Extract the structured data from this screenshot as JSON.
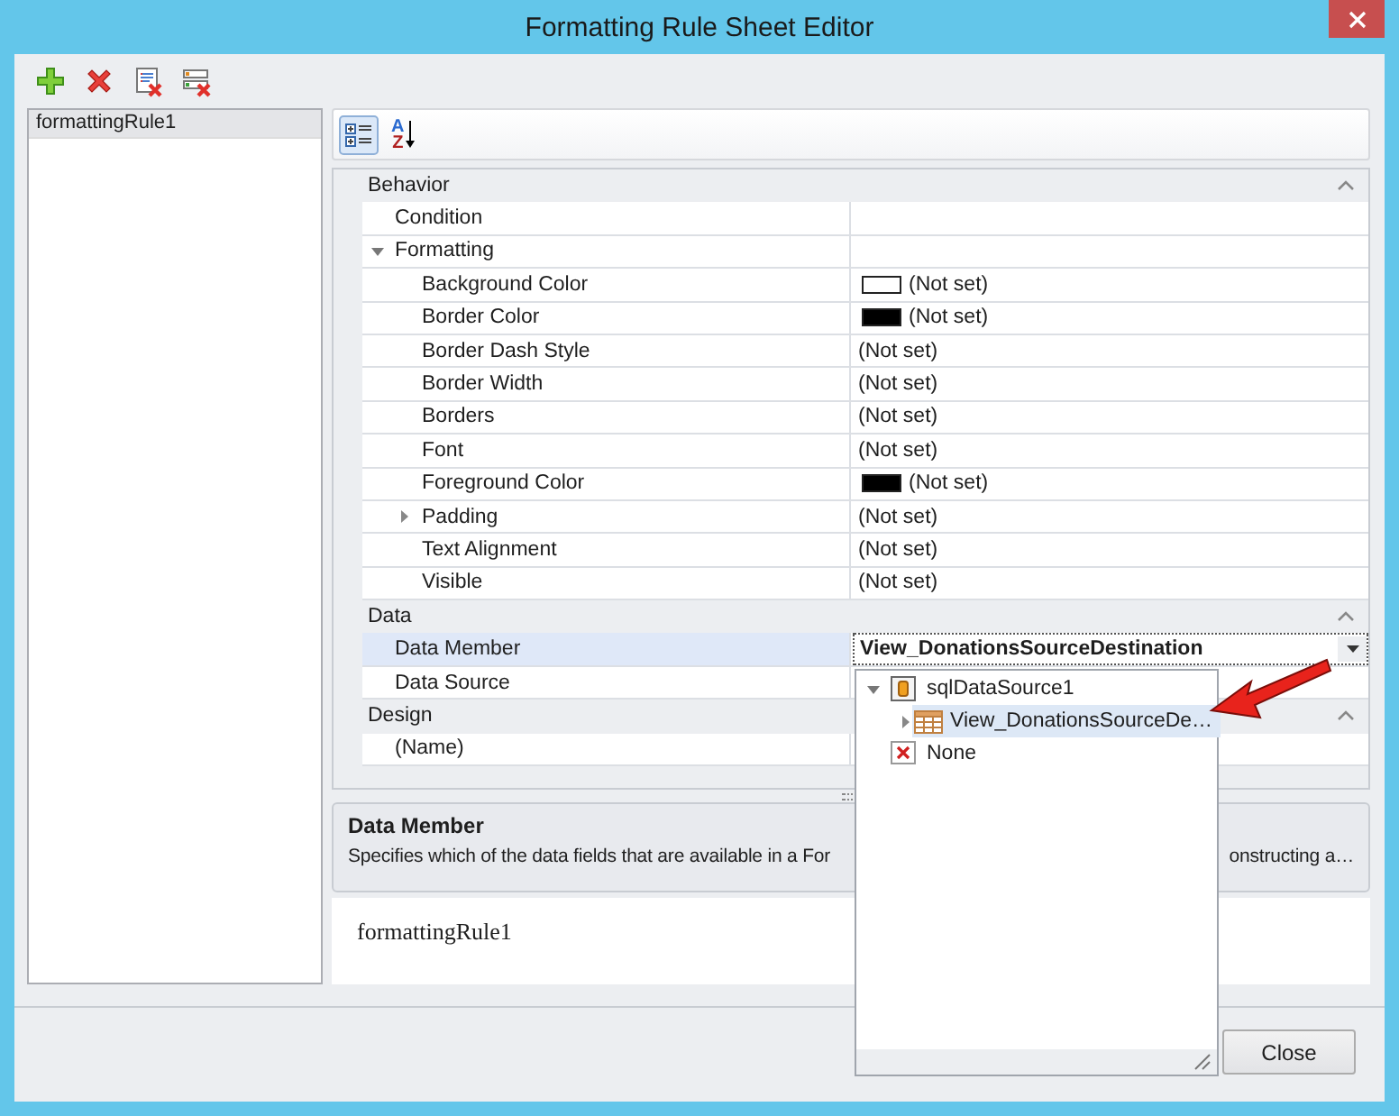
{
  "window": {
    "title": "Formatting Rule Sheet Editor"
  },
  "toolbar": [
    {
      "kind": "add"
    },
    {
      "kind": "delete"
    },
    {
      "kind": "delete-sheet"
    },
    {
      "kind": "delete-list"
    }
  ],
  "rules": [
    {
      "label": "formattingRule1",
      "selected": true
    }
  ],
  "grid_toolbar": [
    {
      "kind": "categorized",
      "selected": true
    },
    {
      "kind": "alphabetical",
      "selected": false,
      "glyphs": [
        "A",
        "Z"
      ]
    }
  ],
  "categories": [
    {
      "name": "Behavior",
      "expanded": true,
      "properties": [
        {
          "name": "Condition",
          "selected": false
        },
        {
          "name": "Formatting",
          "expanded": true,
          "selected": false,
          "children": [
            {
              "name": "Background Color",
              "value": "(Not set)",
              "color": "#ffffff",
              "selected": false
            },
            {
              "name": "Border Color",
              "value": "(Not set)",
              "color": "#000000",
              "selected": false
            },
            {
              "name": "Border Dash Style",
              "value": "(Not set)",
              "selected": false
            },
            {
              "name": "Border Width",
              "value": "(Not set)",
              "selected": false
            },
            {
              "name": "Borders",
              "value": "(Not set)",
              "selected": false
            },
            {
              "name": "Font",
              "value": "(Not set)",
              "selected": false
            },
            {
              "name": "Foreground Color",
              "value": "(Not set)",
              "color": "#000000",
              "selected": false
            },
            {
              "name": "Padding",
              "value": "(Not set)",
              "expanded": false,
              "selected": false
            },
            {
              "name": "Text Alignment",
              "value": "(Not set)",
              "selected": false
            },
            {
              "name": "Visible",
              "value": "(Not set)",
              "selected": false
            }
          ]
        }
      ]
    },
    {
      "name": "Data",
      "expanded": true,
      "properties": [
        {
          "name": "Data Member",
          "value": "View_DonationsSourceDestination",
          "selected": true
        },
        {
          "name": "Data Source",
          "selected": false
        }
      ]
    },
    {
      "name": "Design",
      "expanded": true,
      "properties": [
        {
          "name": "(Name)",
          "selected": false
        }
      ]
    }
  ],
  "description": {
    "title": "Data Member",
    "text_fragments": [
      "Specifies which of the data fields that are available in a For",
      "onstructing a…"
    ]
  },
  "name_preview": "formattingRule1",
  "dropdown": {
    "items": [
      {
        "label": "sqlDataSource1",
        "kind": "datasource",
        "expanded": true,
        "selected": false,
        "children": [
          {
            "label": "View_DonationsSourceDe…",
            "kind": "view",
            "expanded": false,
            "selected": true
          }
        ]
      },
      {
        "label": "None",
        "kind": "none",
        "selected": false
      }
    ]
  },
  "annotations": [
    {
      "kind": "arrow",
      "color": "#e8231c"
    }
  ],
  "buttons": [
    {
      "label": "Close"
    }
  ]
}
